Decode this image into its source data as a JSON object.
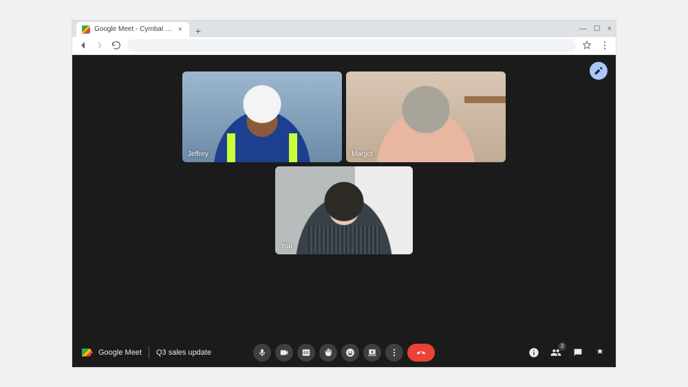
{
  "browser": {
    "tab_title": "Google Meet - Cymbal intro"
  },
  "meet": {
    "brand": "Google Meet",
    "meeting_name": "Q3 sales update",
    "participant_count": "3",
    "participants": [
      {
        "name": "Jeffrey"
      },
      {
        "name": "Margot"
      },
      {
        "name": "You"
      }
    ]
  }
}
